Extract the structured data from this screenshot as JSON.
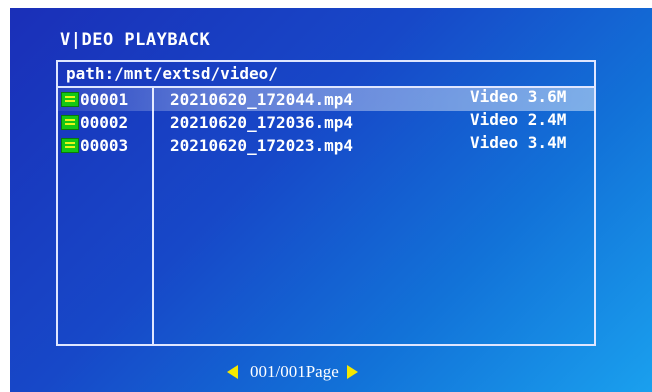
{
  "header": {
    "title": "V|DEO PLAYBACK"
  },
  "browser": {
    "path": "path:/mnt/extsd/video/",
    "files": [
      {
        "index": "00001",
        "name": "20210620_172044.mp4",
        "info": "Video 3.6M",
        "icon": "video-file-icon",
        "selected": true
      },
      {
        "index": "00002",
        "name": "20210620_172036.mp4",
        "info": "Video 2.4M",
        "icon": "video-file-icon",
        "selected": false
      },
      {
        "index": "00003",
        "name": "20210620_172023.mp4",
        "info": "Video 3.4M",
        "icon": "video-file-icon",
        "selected": false
      }
    ]
  },
  "footer": {
    "page": "001/001Page",
    "prev_icon": "arrow-left-icon",
    "next_icon": "arrow-right-icon"
  },
  "colors": {
    "background_start": "#1a2fb8",
    "background_end": "#1aa0ee",
    "icon_green": "#14c814",
    "arrow_yellow": "#f5e800"
  }
}
